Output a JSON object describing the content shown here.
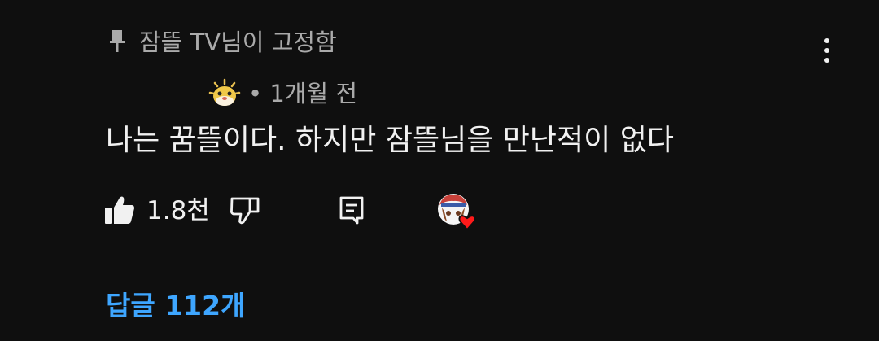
{
  "pinned": {
    "label": "잠뜰 TV님이 고정함",
    "icon": "pin-icon"
  },
  "menu": {
    "icon": "more-vertical-icon"
  },
  "comment": {
    "author_avatar_icon": "pufferfish-avatar-icon",
    "time": "• 1개월 전",
    "text": "나는 꿈뜰이다. 하지만 잠뜰님을 만난적이 없다"
  },
  "actions": {
    "like_icon": "thumbs-up-icon",
    "like_count": "1.8천",
    "dislike_icon": "thumbs-down-icon",
    "reply_icon": "reply-icon",
    "creator_heart_icon": "creator-heart-avatar-icon"
  },
  "replies": {
    "label": "답글 112개",
    "color": "#3ea6ff"
  },
  "colors": {
    "background": "#0f0f0f",
    "primary_text": "#f1f1f1",
    "secondary_text": "#aaaaaa",
    "heart": "#ff0000",
    "link": "#3ea6ff"
  }
}
